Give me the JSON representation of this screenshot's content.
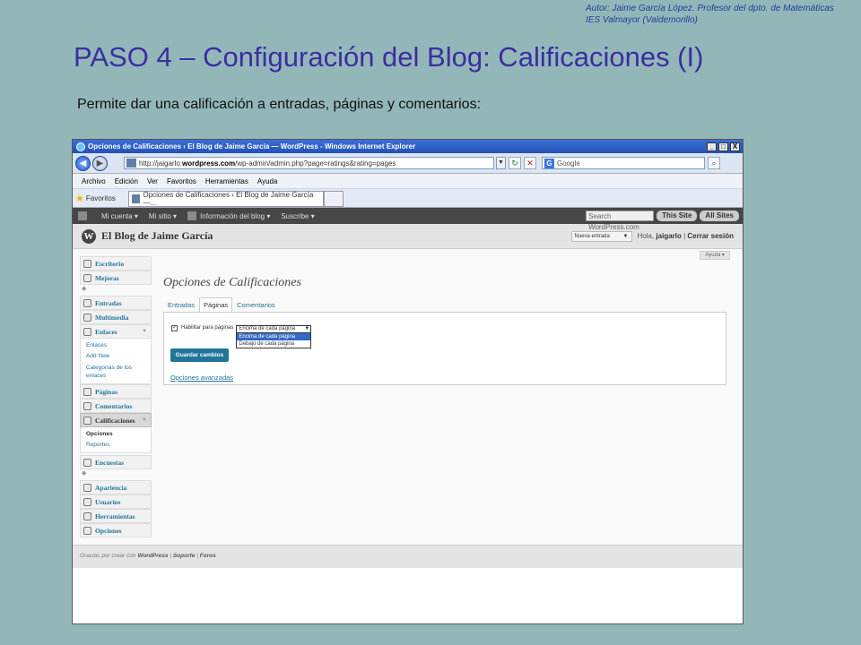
{
  "slide": {
    "author_line1": "Autor: Jaime García López. Profesor del dpto. de Matemáticas",
    "author_line2": "IES Valmayor (Valdemorillo)",
    "title": "PASO 4 – Configuración del Blog: Calificaciones (I)",
    "subtitle": "Permite dar una calificación a entradas, páginas y comentarios:"
  },
  "browser": {
    "window_title": "Opciones de Calificaciones ‹ El Blog de Jaime García — WordPress - Windows Internet Explorer",
    "window_buttons": [
      "_",
      "□",
      "X"
    ],
    "url_prefix": "http://jaigarlo.",
    "url_domain": "wordpress.com",
    "url_suffix": "/wp-admin/admin.php?page=ratings&rating=pages",
    "search_placeholder": "Google",
    "menu": [
      "Archivo",
      "Edición",
      "Ver",
      "Favoritos",
      "Herramientas",
      "Ayuda"
    ],
    "favorites_label": "Favoritos",
    "tab_title": "Opciones de Calificaciones ‹ El Blog de Jaime García —..."
  },
  "adminbar": {
    "items": [
      "Mi cuenta ▾",
      "Mi sitio ▾",
      "Información del blog ▾",
      "Suscribe ▾"
    ],
    "search_placeholder": "Search WordPress.com",
    "btn_this_site": "This Site",
    "btn_all_sites": "All Sites"
  },
  "wphead": {
    "blog_name": "El Blog de Jaime García",
    "new_entry": "Nueva entrada",
    "hello": "Hola,",
    "username": "jaigarlo",
    "logout": "Cerrar sesión"
  },
  "help": "Ayuda ▾",
  "sidebar": {
    "group1": [
      {
        "label": "Escritorio"
      },
      {
        "label": "Mejoras"
      }
    ],
    "group2": [
      {
        "label": "Entradas"
      },
      {
        "label": "Multimedia"
      },
      {
        "label": "Enlaces"
      }
    ],
    "enlaces_sub": [
      "Enlaces",
      "Add New",
      "Categorías de los enlaces"
    ],
    "group2b": [
      {
        "label": "Páginas"
      },
      {
        "label": "Comentarios"
      },
      {
        "label": "Calificaciones"
      }
    ],
    "calif_sub": [
      "Opciones",
      "Reportes"
    ],
    "encuestas": "Encuestas",
    "group3": [
      {
        "label": "Apariencia"
      },
      {
        "label": "Usuarios"
      },
      {
        "label": "Herramientas"
      },
      {
        "label": "Opciones"
      }
    ]
  },
  "main": {
    "heading": "Opciones de Calificaciones",
    "tabs": [
      "Entradas",
      "Páginas",
      "Comentarios"
    ],
    "enable_label": "Habilitar para páginas",
    "select_value": "Encima de cada página",
    "select_options": [
      "Encima de cada página",
      "Debajo de cada página"
    ],
    "save_button": "Guardar cambios",
    "advanced_link": "Opciones avanzadas"
  },
  "footer": {
    "thanks": "Gracias por crear con",
    "wordpress": "WordPress",
    "support": "Soporte",
    "forums": "Foros"
  }
}
